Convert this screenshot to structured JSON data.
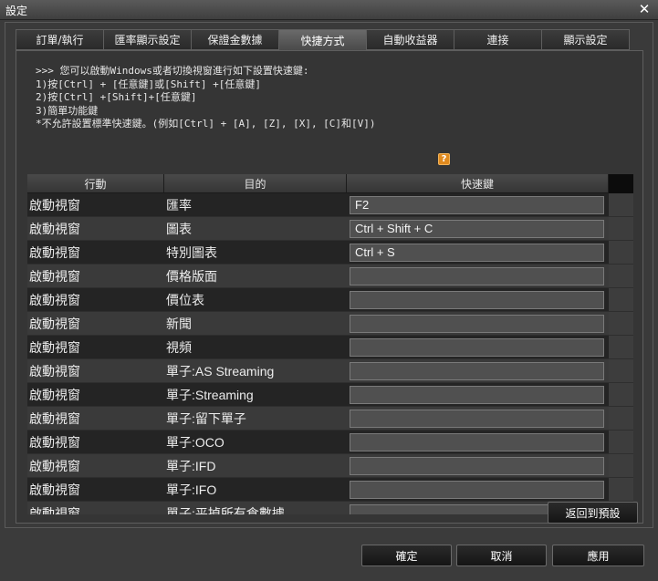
{
  "window": {
    "title": "設定",
    "close_glyph": "✕"
  },
  "tabs": [
    {
      "label": "訂單/執行",
      "active": false
    },
    {
      "label": "匯率顯示設定",
      "active": false
    },
    {
      "label": "保證金數據",
      "active": false
    },
    {
      "label": "快捷方式",
      "active": true
    },
    {
      "label": "自動收益器",
      "active": false
    },
    {
      "label": "連接",
      "active": false
    },
    {
      "label": "顯示設定",
      "active": false
    }
  ],
  "help": {
    "lines": [
      ">>> 您可以啟動Windows或者切換視窗進行如下設置快速鍵:",
      "1)按[Ctrl] + [任意鍵]或[Shift] +[任意鍵]",
      "2)按[Ctrl] +[Shift]+[任意鍵]",
      "3)簡單功能鍵",
      "*不允許設置標準快速鍵。(例如[Ctrl] + [A], [Z], [X], [C]和[V])"
    ],
    "icon_glyph": "?"
  },
  "table": {
    "headers": [
      "行動",
      "目的",
      "快速鍵"
    ],
    "rows": [
      {
        "action": "啟動視窗",
        "target": "匯率",
        "shortcut": "F2"
      },
      {
        "action": "啟動視窗",
        "target": "圖表",
        "shortcut": "Ctrl + Shift + C"
      },
      {
        "action": "啟動視窗",
        "target": "特別圖表",
        "shortcut": "Ctrl + S"
      },
      {
        "action": "啟動視窗",
        "target": "價格版面",
        "shortcut": ""
      },
      {
        "action": "啟動視窗",
        "target": "價位表",
        "shortcut": ""
      },
      {
        "action": "啟動視窗",
        "target": "新聞",
        "shortcut": ""
      },
      {
        "action": "啟動視窗",
        "target": "視頻",
        "shortcut": ""
      },
      {
        "action": "啟動視窗",
        "target": "單子:AS Streaming",
        "shortcut": ""
      },
      {
        "action": "啟動視窗",
        "target": "單子:Streaming",
        "shortcut": ""
      },
      {
        "action": "啟動視窗",
        "target": "單子:留下單子",
        "shortcut": ""
      },
      {
        "action": "啟動視窗",
        "target": "單子:OCO",
        "shortcut": ""
      },
      {
        "action": "啟動視窗",
        "target": "單子:IFD",
        "shortcut": ""
      },
      {
        "action": "啟動視窗",
        "target": "單子:IFO",
        "shortcut": ""
      },
      {
        "action": "啟動視窗",
        "target": "單子:平掉所有倉數據",
        "shortcut": ""
      }
    ]
  },
  "buttons": {
    "reset": "返回到預設",
    "ok": "確定",
    "cancel": "取消",
    "apply": "應用"
  }
}
